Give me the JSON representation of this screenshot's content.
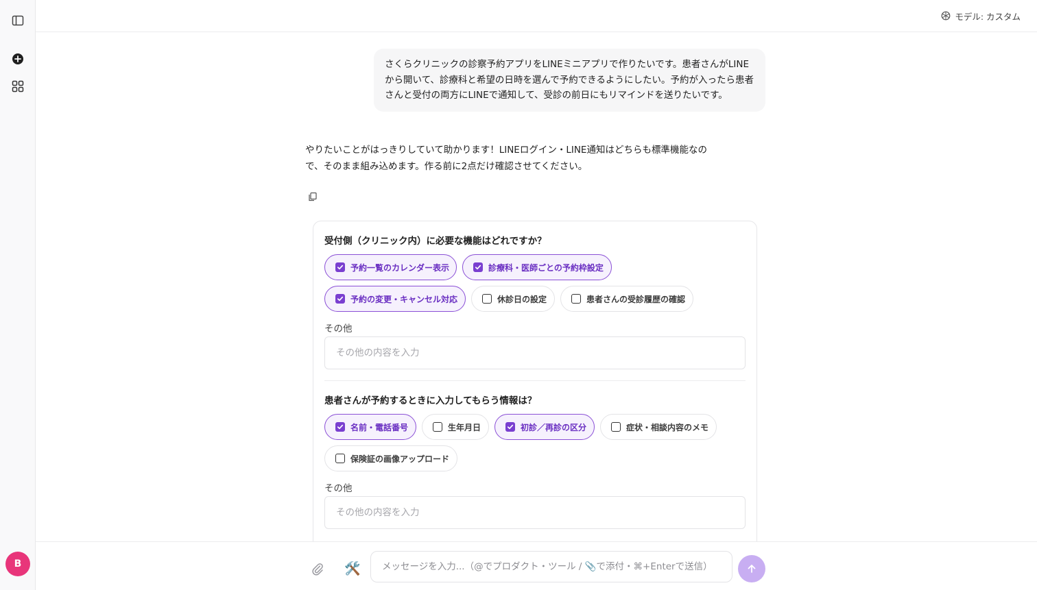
{
  "header": {
    "model_label": "モデル: カスタム"
  },
  "sidebar": {
    "avatar_initial": "B"
  },
  "chat": {
    "user_message": "さくらクリニックの診察予約アプリをLINEミニアプリで作りたいです。患者さんがLINEから開いて、診療科と希望の日時を選んで予約できるようにしたい。予約が入ったら患者さんと受付の両方にLINEで通知して、受診の前日にもリマインドを送りたいです。",
    "assistant_message": "やりたいことがはっきりしていて助かります！LINEログイン・LINE通知はどちらも標準機能なので、そのまま組み込めます。作る前に2点だけ確認させてください。"
  },
  "questions": [
    {
      "title": "受付側（クリニック内）に必要な機能はどれですか？",
      "options": [
        {
          "label": "予約一覧のカレンダー表示",
          "checked": true
        },
        {
          "label": "診療科・医師ごとの予約枠設定",
          "checked": true
        },
        {
          "label": "予約の変更・キャンセル対応",
          "checked": true
        },
        {
          "label": "休診日の設定",
          "checked": false
        },
        {
          "label": "患者さんの受診履歴の確認",
          "checked": false
        }
      ],
      "other_label": "その他",
      "other_placeholder": "その他の内容を入力"
    },
    {
      "title": "患者さんが予約するときに入力してもらう情報は？",
      "options": [
        {
          "label": "名前・電話番号",
          "checked": true
        },
        {
          "label": "生年月日",
          "checked": false
        },
        {
          "label": "初診／再診の区分",
          "checked": true
        },
        {
          "label": "症状・相談内容のメモ",
          "checked": false
        },
        {
          "label": "保険証の画像アップロード",
          "checked": false
        }
      ],
      "other_label": "その他",
      "other_placeholder": "その他の内容を入力"
    }
  ],
  "composer": {
    "placeholder": "メッセージを入力...（@でプロダクト・ツール / 📎で添付・⌘+Enterで送信）",
    "tools_glyph": "🛠️"
  },
  "colors": {
    "accent": "#7a3fd0",
    "accent_bg": "#f6f1fd",
    "avatar": "#e8357a",
    "send_button": "#c8aef2"
  }
}
